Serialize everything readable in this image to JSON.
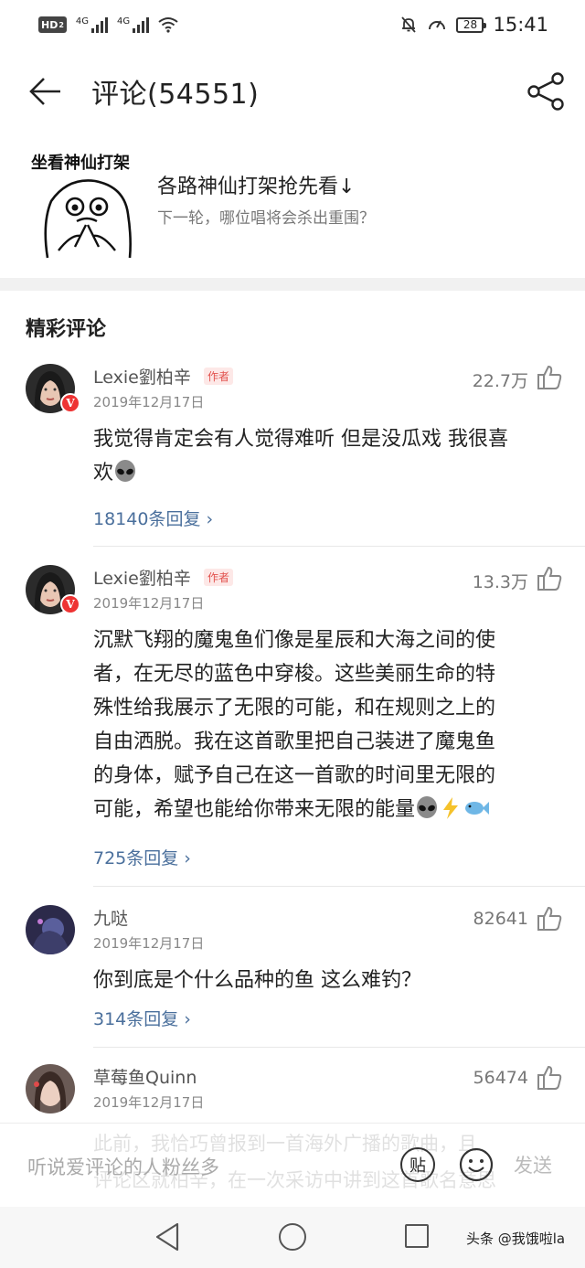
{
  "status_bar": {
    "hd": "HD",
    "hd_sub": "2",
    "net1": "4G",
    "net2": "4G",
    "battery": "28",
    "time": "15:41"
  },
  "header": {
    "title": "评论(54551)"
  },
  "topic": {
    "cover_title": "坐看神仙打架",
    "title": "各路神仙打架抢先看↓",
    "subtitle": "下一轮，哪位唱将会杀出重围？"
  },
  "section_title": "精彩评论",
  "comments": [
    {
      "user": "Lexie劉柏辛",
      "tag": "作者",
      "date": "2019年12月17日",
      "likes": "22.7万",
      "text_lines": [
        "我觉得肯定会有人觉得难听 但是没瓜戏 我很喜",
        "欢"
      ],
      "replies": "18140条回复",
      "emoji": "alien"
    },
    {
      "user": "Lexie劉柏辛",
      "tag": "作者",
      "date": "2019年12月17日",
      "likes": "13.3万",
      "text_lines": [
        "沉默飞翔的魔鬼鱼们像是星辰和大海之间的使",
        "者，在无尽的蓝色中穿梭。这些美丽生命的特",
        "殊性给我展示了无限的可能，和在规则之上的",
        "自由洒脱。我在这首歌里把自己装进了魔鬼鱼",
        "的身体，赋予自己在这一首歌的时间里无限的",
        "可能，希望也能给你带来无限的能量"
      ],
      "replies": "725条回复",
      "emoji": "alien-bolt-fish"
    },
    {
      "user": "九哒",
      "date": "2019年12月17日",
      "likes": "82641",
      "text_lines": [
        "你到底是个什么品种的鱼 这么难钓？"
      ],
      "replies": "314条回复"
    },
    {
      "user": "草莓鱼Quinn",
      "date": "2019年12月17日",
      "likes": "56474",
      "text_lines": [
        "此前，我恰巧曾报到一首海外广播的歌曲，且",
        "评论区就柏辛，在一次采访中讲到这首歌名意思"
      ]
    }
  ],
  "input_bar": {
    "placeholder": "听说爱评论的人粉丝多",
    "sticker_label": "贴",
    "send_label": "发送"
  },
  "watermark": "头条 @我饿啦la",
  "colors": {
    "link": "#4a6f9c",
    "author_tag": "#e2524e",
    "verified": "#e33"
  }
}
